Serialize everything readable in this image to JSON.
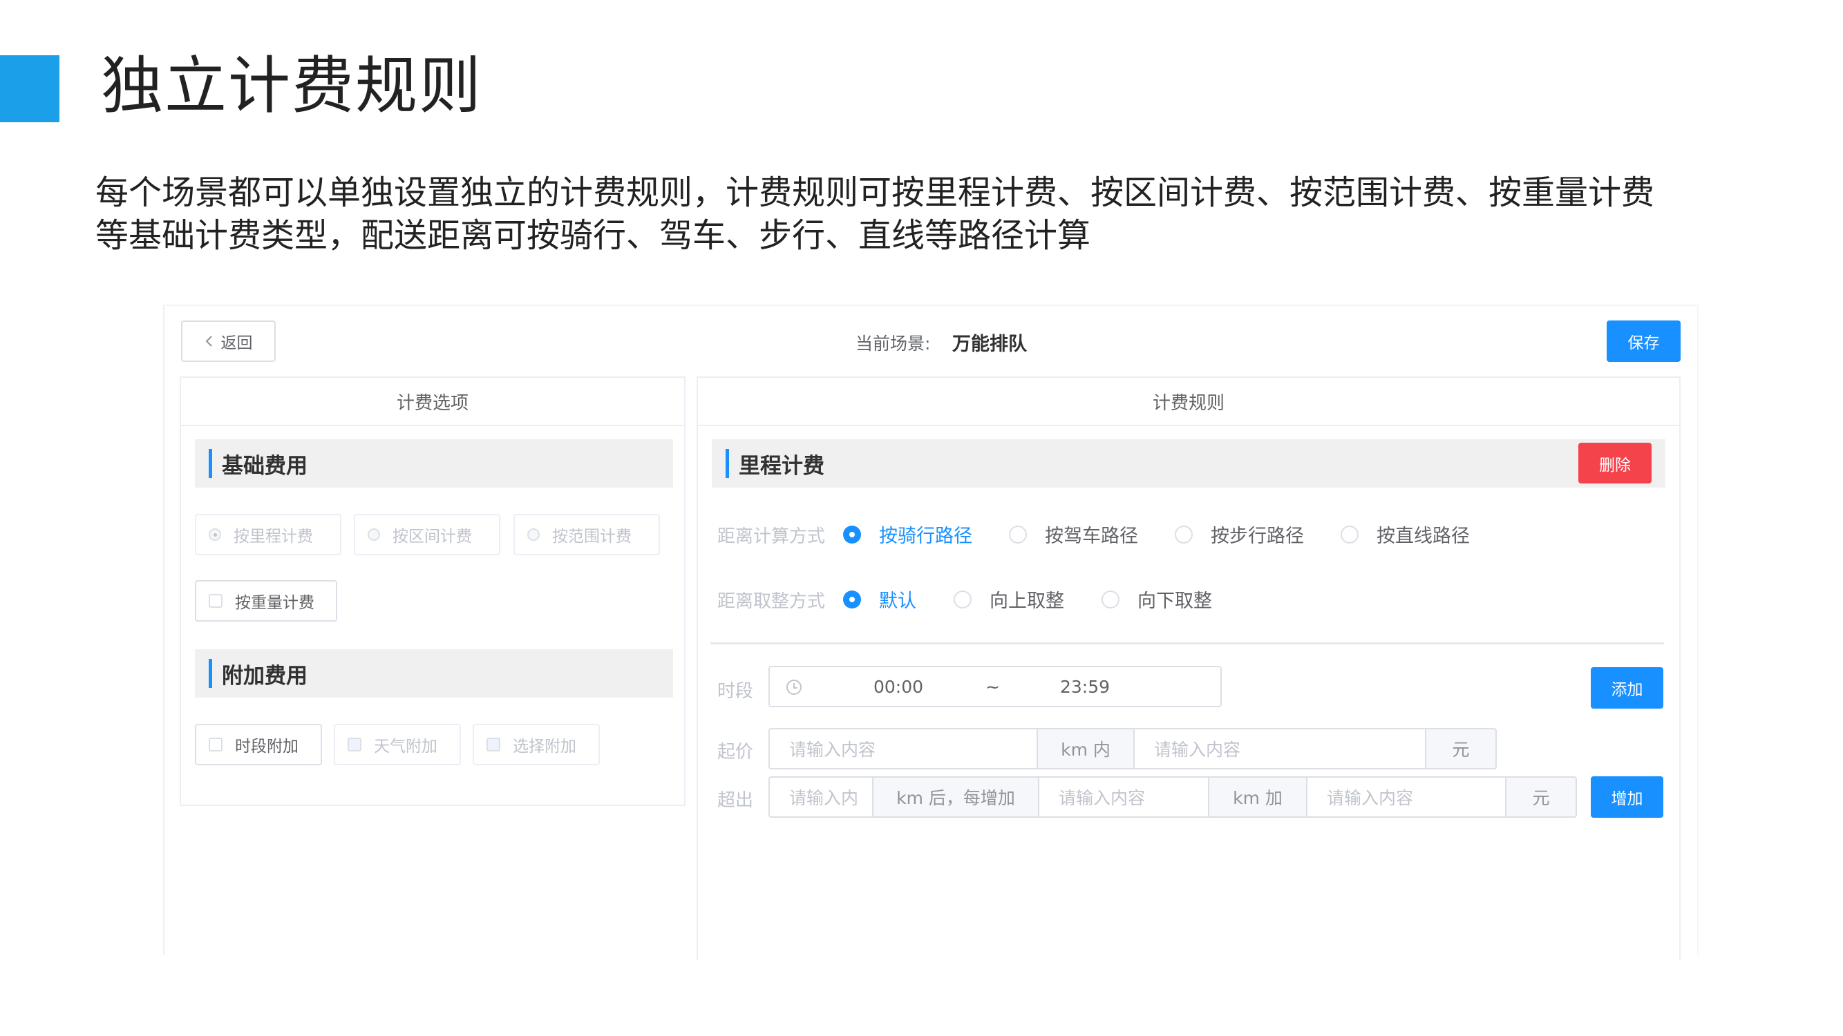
{
  "slide": {
    "title": "独立计费规则",
    "desc_line1": "每个场景都可以单独设置独立的计费规则，计费规则可按里程计费、按区间计费、按范围计费、按重量计费",
    "desc_line2": "等基础计费类型，配送距离可按骑行、驾车、步行、直线等路径计算"
  },
  "toolbar": {
    "back_label": "返回",
    "back_icon": "chevron-left-icon",
    "scene_label": "当前场景:",
    "scene_name": "万能排队",
    "save_label": "保存"
  },
  "left_panel": {
    "header": "计费选项",
    "basic_section": "基础费用",
    "basic_options": [
      {
        "label": "按里程计费",
        "checked": true,
        "disabled": true
      },
      {
        "label": "按区间计费",
        "checked": false,
        "disabled": true
      },
      {
        "label": "按范围计费",
        "checked": false,
        "disabled": true
      }
    ],
    "weight_option": {
      "label": "按重量计费",
      "checked": false,
      "disabled": false
    },
    "extra_section": "附加费用",
    "extra_options": [
      {
        "label": "时段附加",
        "checked": false,
        "disabled": false
      },
      {
        "label": "天气附加",
        "checked": false,
        "disabled": true
      },
      {
        "label": "选择附加",
        "checked": false,
        "disabled": true
      }
    ]
  },
  "right_panel": {
    "header": "计费规则",
    "section": "里程计费",
    "delete_label": "删除",
    "distance_method": {
      "label": "距离计算方式",
      "options": [
        "按骑行路径",
        "按驾车路径",
        "按步行路径",
        "按直线路径"
      ],
      "selected": "按骑行路径"
    },
    "rounding": {
      "label": "距离取整方式",
      "options": [
        "默认",
        "向上取整",
        "向下取整"
      ],
      "selected": "默认"
    },
    "period": {
      "label": "时段",
      "start": "00:00",
      "separator": "~",
      "end": "23:59",
      "add_label": "添加"
    },
    "base_price": {
      "label": "起价",
      "placeholder1": "请输入内容",
      "unit1": "km 内",
      "placeholder2": "请输入内容",
      "unit2": "元"
    },
    "overage": {
      "label": "超出",
      "placeholder1": "请输入内",
      "unit1": "km 后，每增加",
      "placeholder2": "请输入内容",
      "unit2": "km 加",
      "placeholder3": "请输入内容",
      "unit3": "元",
      "add_label": "增加"
    }
  },
  "colors": {
    "accent": "#1a9fe8",
    "primary": "#1890ff",
    "danger": "#f5434b",
    "section_bg": "#f0f0f0"
  }
}
